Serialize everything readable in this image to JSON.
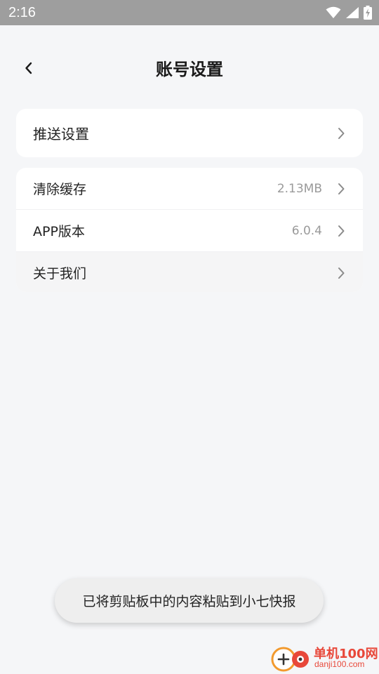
{
  "status_bar": {
    "time": "2:16",
    "icons": [
      "wifi-icon",
      "signal-icon",
      "battery-charging-icon"
    ]
  },
  "header": {
    "title": "账号设置",
    "back_icon": "chevron-left-icon"
  },
  "push_card": {
    "label": "推送设置"
  },
  "settings": [
    {
      "label": "清除缓存",
      "value": "2.13MB"
    },
    {
      "label": "APP版本",
      "value": "6.0.4"
    },
    {
      "label": "关于我们",
      "value": ""
    }
  ],
  "toast": {
    "text": "已将剪贴板中的内容粘贴到小七快报"
  },
  "watermark": {
    "name": "单机100网",
    "url": "danji100.com"
  },
  "colors": {
    "background": "#f5f6f8",
    "status_bar": "#9e9e9e",
    "card": "#ffffff",
    "watermark": "#e8483a"
  }
}
